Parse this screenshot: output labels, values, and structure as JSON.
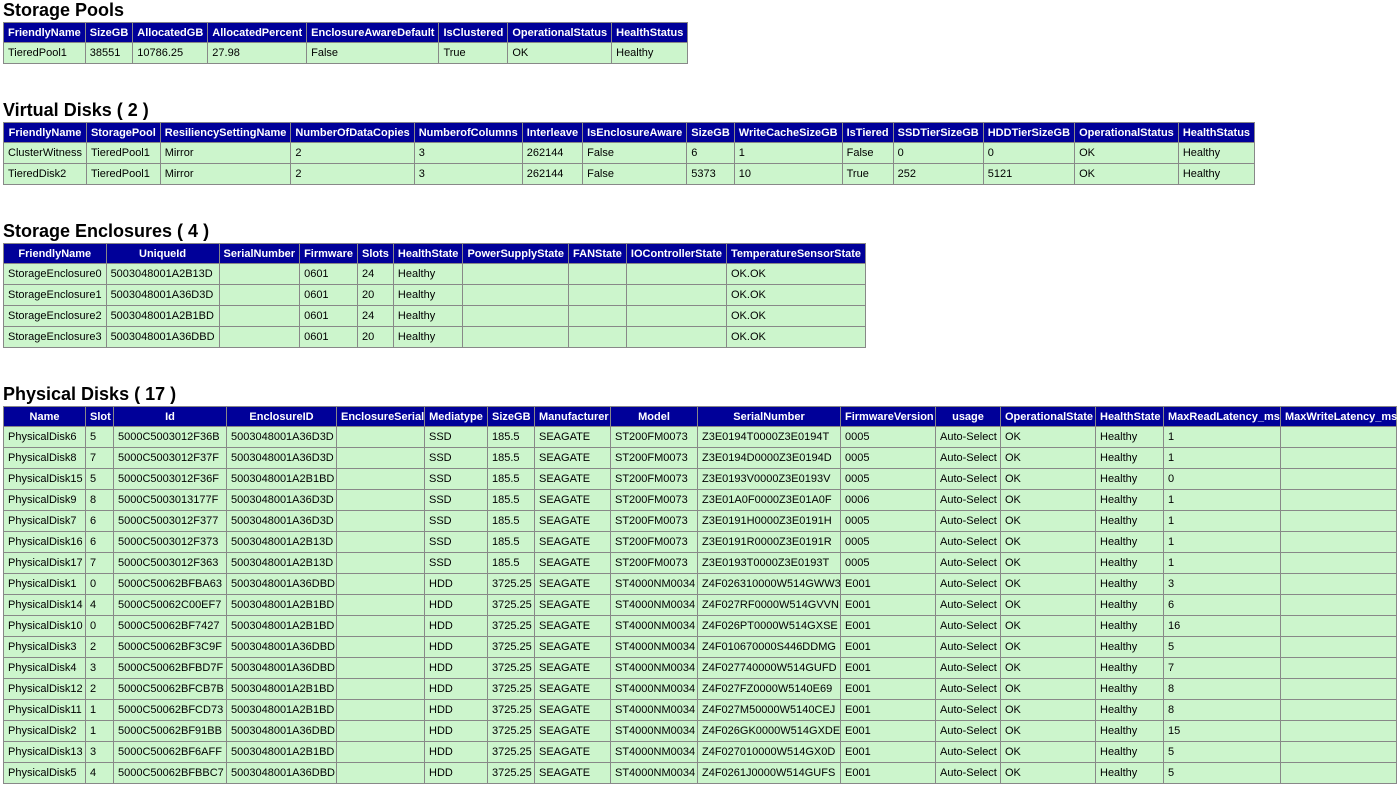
{
  "sections": [
    {
      "id": "pools",
      "title": "Storage Pools",
      "columns": [
        "FriendlyName",
        "SizeGB",
        "AllocatedGB",
        "AllocatedPercent",
        "EnclosureAwareDefault",
        "IsClustered",
        "OperationalStatus",
        "HealthStatus"
      ],
      "rows": [
        [
          "TieredPool1",
          "38551",
          "10786.25",
          "27.98",
          "False",
          "True",
          "OK",
          "Healthy"
        ]
      ]
    },
    {
      "id": "vdisks",
      "title": "Virtual Disks ( 2 )",
      "columns": [
        "FriendlyName",
        "StoragePool",
        "ResiliencySettingName",
        "NumberOfDataCopies",
        "NumberofColumns",
        "Interleave",
        "IsEnclosureAware",
        "SizeGB",
        "WriteCacheSizeGB",
        "IsTiered",
        "SSDTierSizeGB",
        "HDDTierSizeGB",
        "OperationalStatus",
        "HealthStatus"
      ],
      "rows": [
        [
          "ClusterWitness",
          "TieredPool1",
          "Mirror",
          "2",
          "3",
          "262144",
          "False",
          "6",
          "1",
          "False",
          "0",
          "0",
          "OK",
          "Healthy"
        ],
        [
          "TieredDisk2",
          "TieredPool1",
          "Mirror",
          "2",
          "3",
          "262144",
          "False",
          "5373",
          "10",
          "True",
          "252",
          "5121",
          "OK",
          "Healthy"
        ]
      ]
    },
    {
      "id": "encl",
      "title": "Storage Enclosures ( 4 )",
      "columns": [
        "FriendlyName",
        "UniqueId",
        "SerialNumber",
        "Firmware",
        "Slots",
        "HealthState",
        "PowerSupplyState",
        "FANState",
        "IOControllerState",
        "TemperatureSensorState"
      ],
      "rows": [
        [
          "StorageEnclosure0",
          "5003048001A2B13D",
          "",
          "0601",
          "24",
          "Healthy",
          "",
          "",
          "",
          "OK.OK"
        ],
        [
          "StorageEnclosure1",
          "5003048001A36D3D",
          "",
          "0601",
          "20",
          "Healthy",
          "",
          "",
          "",
          "OK.OK"
        ],
        [
          "StorageEnclosure2",
          "5003048001A2B1BD",
          "",
          "0601",
          "24",
          "Healthy",
          "",
          "",
          "",
          "OK.OK"
        ],
        [
          "StorageEnclosure3",
          "5003048001A36DBD",
          "",
          "0601",
          "20",
          "Healthy",
          "",
          "",
          "",
          "OK.OK"
        ]
      ]
    },
    {
      "id": "pdisks",
      "title": "Physical Disks ( 17 )",
      "columns": [
        "Name",
        "Slot",
        "Id",
        "EnclosureID",
        "EnclosureSerial",
        "Mediatype",
        "SizeGB",
        "Manufacturer",
        "Model",
        "SerialNumber",
        "FirmwareVersion",
        "usage",
        "OperationalState",
        "HealthState",
        "MaxReadLatency_ms",
        "MaxWriteLatency_ms"
      ],
      "rows": [
        [
          "PhysicalDisk6",
          "5",
          "5000C5003012F36B",
          "5003048001A36D3D",
          "",
          "SSD",
          "185.5",
          "SEAGATE",
          "ST200FM0073",
          "Z3E0194T0000Z3E0194T",
          "0005",
          "Auto-Select",
          "OK",
          "Healthy",
          "1",
          ""
        ],
        [
          "PhysicalDisk8",
          "7",
          "5000C5003012F37F",
          "5003048001A36D3D",
          "",
          "SSD",
          "185.5",
          "SEAGATE",
          "ST200FM0073",
          "Z3E0194D0000Z3E0194D",
          "0005",
          "Auto-Select",
          "OK",
          "Healthy",
          "1",
          ""
        ],
        [
          "PhysicalDisk15",
          "5",
          "5000C5003012F36F",
          "5003048001A2B1BD",
          "",
          "SSD",
          "185.5",
          "SEAGATE",
          "ST200FM0073",
          "Z3E0193V0000Z3E0193V",
          "0005",
          "Auto-Select",
          "OK",
          "Healthy",
          "0",
          ""
        ],
        [
          "PhysicalDisk9",
          "8",
          "5000C5003013177F",
          "5003048001A36D3D",
          "",
          "SSD",
          "185.5",
          "SEAGATE",
          "ST200FM0073",
          "Z3E01A0F0000Z3E01A0F",
          "0006",
          "Auto-Select",
          "OK",
          "Healthy",
          "1",
          ""
        ],
        [
          "PhysicalDisk7",
          "6",
          "5000C5003012F377",
          "5003048001A36D3D",
          "",
          "SSD",
          "185.5",
          "SEAGATE",
          "ST200FM0073",
          "Z3E0191H0000Z3E0191H",
          "0005",
          "Auto-Select",
          "OK",
          "Healthy",
          "1",
          ""
        ],
        [
          "PhysicalDisk16",
          "6",
          "5000C5003012F373",
          "5003048001A2B13D",
          "",
          "SSD",
          "185.5",
          "SEAGATE",
          "ST200FM0073",
          "Z3E0191R0000Z3E0191R",
          "0005",
          "Auto-Select",
          "OK",
          "Healthy",
          "1",
          ""
        ],
        [
          "PhysicalDisk17",
          "7",
          "5000C5003012F363",
          "5003048001A2B13D",
          "",
          "SSD",
          "185.5",
          "SEAGATE",
          "ST200FM0073",
          "Z3E0193T0000Z3E0193T",
          "0005",
          "Auto-Select",
          "OK",
          "Healthy",
          "1",
          ""
        ],
        [
          "PhysicalDisk1",
          "0",
          "5000C50062BFBA63",
          "5003048001A36DBD",
          "",
          "HDD",
          "3725.25",
          "SEAGATE",
          "ST4000NM0034",
          "Z4F026310000W514GWW3",
          "E001",
          "Auto-Select",
          "OK",
          "Healthy",
          "3",
          ""
        ],
        [
          "PhysicalDisk14",
          "4",
          "5000C50062C00EF7",
          "5003048001A2B1BD",
          "",
          "HDD",
          "3725.25",
          "SEAGATE",
          "ST4000NM0034",
          "Z4F027RF0000W514GVVN",
          "E001",
          "Auto-Select",
          "OK",
          "Healthy",
          "6",
          ""
        ],
        [
          "PhysicalDisk10",
          "0",
          "5000C50062BF7427",
          "5003048001A2B1BD",
          "",
          "HDD",
          "3725.25",
          "SEAGATE",
          "ST4000NM0034",
          "Z4F026PT0000W514GXSE",
          "E001",
          "Auto-Select",
          "OK",
          "Healthy",
          "16",
          ""
        ],
        [
          "PhysicalDisk3",
          "2",
          "5000C50062BF3C9F",
          "5003048001A36DBD",
          "",
          "HDD",
          "3725.25",
          "SEAGATE",
          "ST4000NM0034",
          "Z4F010670000S446DDMG",
          "E001",
          "Auto-Select",
          "OK",
          "Healthy",
          "5",
          ""
        ],
        [
          "PhysicalDisk4",
          "3",
          "5000C50062BFBD7F",
          "5003048001A36DBD",
          "",
          "HDD",
          "3725.25",
          "SEAGATE",
          "ST4000NM0034",
          "Z4F027740000W514GUFD",
          "E001",
          "Auto-Select",
          "OK",
          "Healthy",
          "7",
          ""
        ],
        [
          "PhysicalDisk12",
          "2",
          "5000C50062BFCB7B",
          "5003048001A2B1BD",
          "",
          "HDD",
          "3725.25",
          "SEAGATE",
          "ST4000NM0034",
          "Z4F027FZ0000W5140E69",
          "E001",
          "Auto-Select",
          "OK",
          "Healthy",
          "8",
          ""
        ],
        [
          "PhysicalDisk11",
          "1",
          "5000C50062BFCD73",
          "5003048001A2B1BD",
          "",
          "HDD",
          "3725.25",
          "SEAGATE",
          "ST4000NM0034",
          "Z4F027M50000W5140CEJ",
          "E001",
          "Auto-Select",
          "OK",
          "Healthy",
          "8",
          ""
        ],
        [
          "PhysicalDisk2",
          "1",
          "5000C50062BF91BB",
          "5003048001A36DBD",
          "",
          "HDD",
          "3725.25",
          "SEAGATE",
          "ST4000NM0034",
          "Z4F026GK0000W514GXDE",
          "E001",
          "Auto-Select",
          "OK",
          "Healthy",
          "15",
          ""
        ],
        [
          "PhysicalDisk13",
          "3",
          "5000C50062BF6AFF",
          "5003048001A2B1BD",
          "",
          "HDD",
          "3725.25",
          "SEAGATE",
          "ST4000NM0034",
          "Z4F027010000W514GX0D",
          "E001",
          "Auto-Select",
          "OK",
          "Healthy",
          "5",
          ""
        ],
        [
          "PhysicalDisk5",
          "4",
          "5000C50062BFBBC7",
          "5003048001A36DBD",
          "",
          "HDD",
          "3725.25",
          "SEAGATE",
          "ST4000NM0034",
          "Z4F0261J0000W514GUFS",
          "E001",
          "Auto-Select",
          "OK",
          "Healthy",
          "5",
          ""
        ]
      ]
    }
  ],
  "colors": {
    "header_bg": "#000099",
    "header_text": "#ffffff",
    "cell_bg": "#ccf5cc",
    "border": "#888888"
  }
}
